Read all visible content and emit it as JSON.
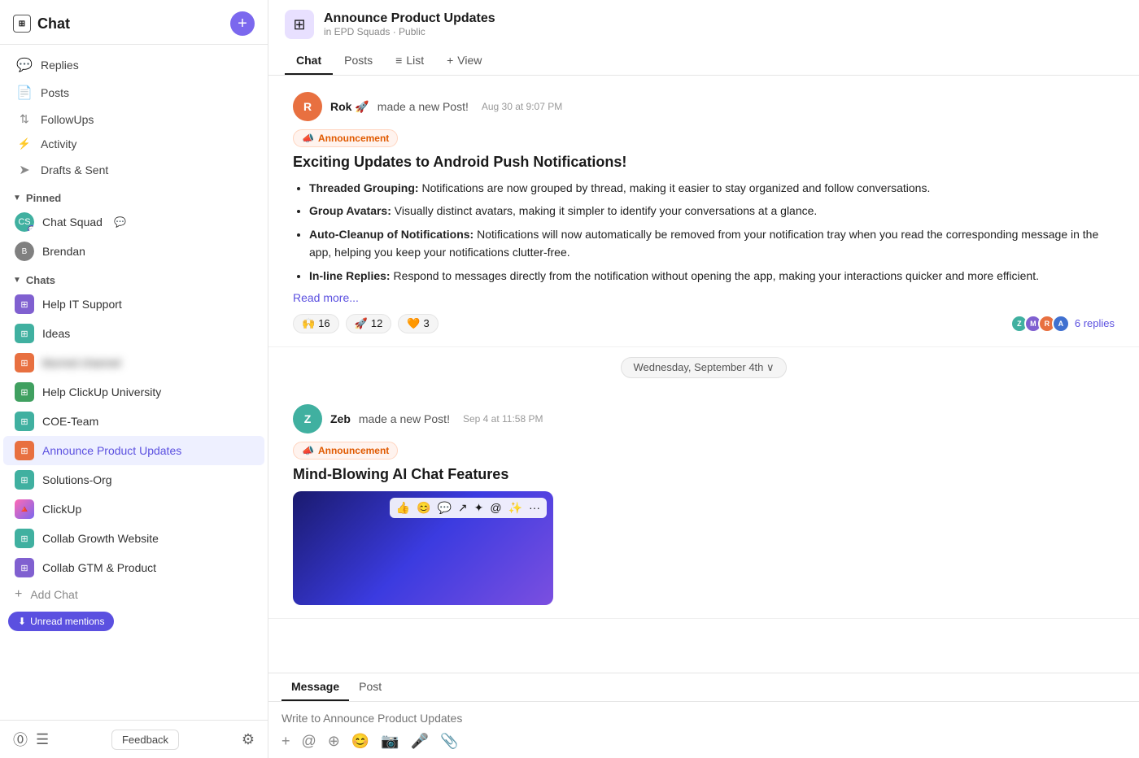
{
  "sidebar": {
    "title": "Chat",
    "add_button_label": "+",
    "nav_items": [
      {
        "id": "replies",
        "label": "Replies",
        "icon": "💬"
      },
      {
        "id": "posts",
        "label": "Posts",
        "icon": "📄"
      },
      {
        "id": "followups",
        "label": "FollowUps",
        "icon": "↕"
      },
      {
        "id": "activity",
        "label": "Activity",
        "icon": "📈"
      },
      {
        "id": "drafts",
        "label": "Drafts & Sent",
        "icon": "➤"
      }
    ],
    "pinned_section": "Pinned",
    "pinned_items": [
      {
        "id": "chat-squad",
        "label": "Chat Squad",
        "has_bubble": true
      },
      {
        "id": "brendan",
        "label": "Brendan"
      }
    ],
    "chats_section": "Chats",
    "chat_items": [
      {
        "id": "help-it",
        "label": "Help IT Support",
        "color": "ci-purple"
      },
      {
        "id": "ideas",
        "label": "Ideas",
        "color": "ci-teal"
      },
      {
        "id": "blurred",
        "label": "",
        "blurred": true,
        "color": "ci-orange"
      },
      {
        "id": "help-clickup",
        "label": "Help ClickUp University",
        "color": "ci-green"
      },
      {
        "id": "coe-team",
        "label": "COE-Team",
        "color": "ci-teal"
      },
      {
        "id": "announce-product-updates",
        "label": "Announce Product Updates",
        "color": "ci-orange",
        "active": true
      },
      {
        "id": "solutions-org",
        "label": "Solutions-Org",
        "color": "ci-teal"
      },
      {
        "id": "clickup",
        "label": "ClickUp",
        "color": "ci-blue",
        "is_logo": true
      },
      {
        "id": "collab-growth",
        "label": "Collab Growth Website",
        "color": "ci-teal"
      },
      {
        "id": "collab-gtm",
        "label": "Collab GTM & Product",
        "color": "ci-purple"
      }
    ],
    "add_chat_label": "Add Chat",
    "unread_mentions_label": "Unread mentions",
    "feedback_label": "Feedback"
  },
  "channel": {
    "name": "Announce Product Updates",
    "subtitle": "in EPD Squads · Public",
    "tabs": [
      {
        "id": "chat",
        "label": "Chat",
        "active": true
      },
      {
        "id": "posts",
        "label": "Posts"
      },
      {
        "id": "list",
        "label": "List",
        "icon": "≡"
      },
      {
        "id": "view",
        "label": "View",
        "icon": "+"
      }
    ]
  },
  "messages": [
    {
      "id": "msg1",
      "author": "Rok 🚀",
      "action": "made a new Post!",
      "time": "Aug 30 at 9:07 PM",
      "avatar_color": "av-orange",
      "avatar_letter": "R",
      "badge": "📣 Announcement",
      "post_title": "Exciting Updates to Android Push Notifications!",
      "bullets": [
        {
          "bold": "Threaded Grouping:",
          "text": " Notifications are now grouped by thread, making it easier to stay organized and follow conversations."
        },
        {
          "bold": "Group Avatars:",
          "text": " Visually distinct avatars, making it simpler to identify your conversations at a glance."
        },
        {
          "bold": "Auto-Cleanup of Notifications:",
          "text": " Notifications will now automatically be removed from your notification tray when you read the corresponding message in the app, helping you keep your notifications clutter-free."
        },
        {
          "bold": "In-line Replies:",
          "text": " Respond to messages directly from the notification without opening the app, making your interactions quicker and more efficient."
        }
      ],
      "read_more_label": "Read more...",
      "reactions": [
        {
          "emoji": "🙌",
          "count": "16"
        },
        {
          "emoji": "🚀",
          "count": "12"
        },
        {
          "emoji": "🧡",
          "count": "3"
        }
      ],
      "replies_count": "6 replies"
    },
    {
      "id": "msg2",
      "author": "Zeb",
      "action": "made a new Post!",
      "time": "Sep 4 at 11:58 PM",
      "avatar_color": "av-teal",
      "avatar_letter": "Z",
      "badge": "📣 Announcement",
      "post_title": "Mind-Blowing AI Chat Features",
      "has_image": true
    }
  ],
  "date_divider": {
    "label": "Wednesday, September 4th ∨"
  },
  "message_input": {
    "tabs": [
      {
        "id": "message",
        "label": "Message",
        "active": true
      },
      {
        "id": "post",
        "label": "Post"
      }
    ],
    "placeholder": "Write to Announce Product Updates"
  }
}
